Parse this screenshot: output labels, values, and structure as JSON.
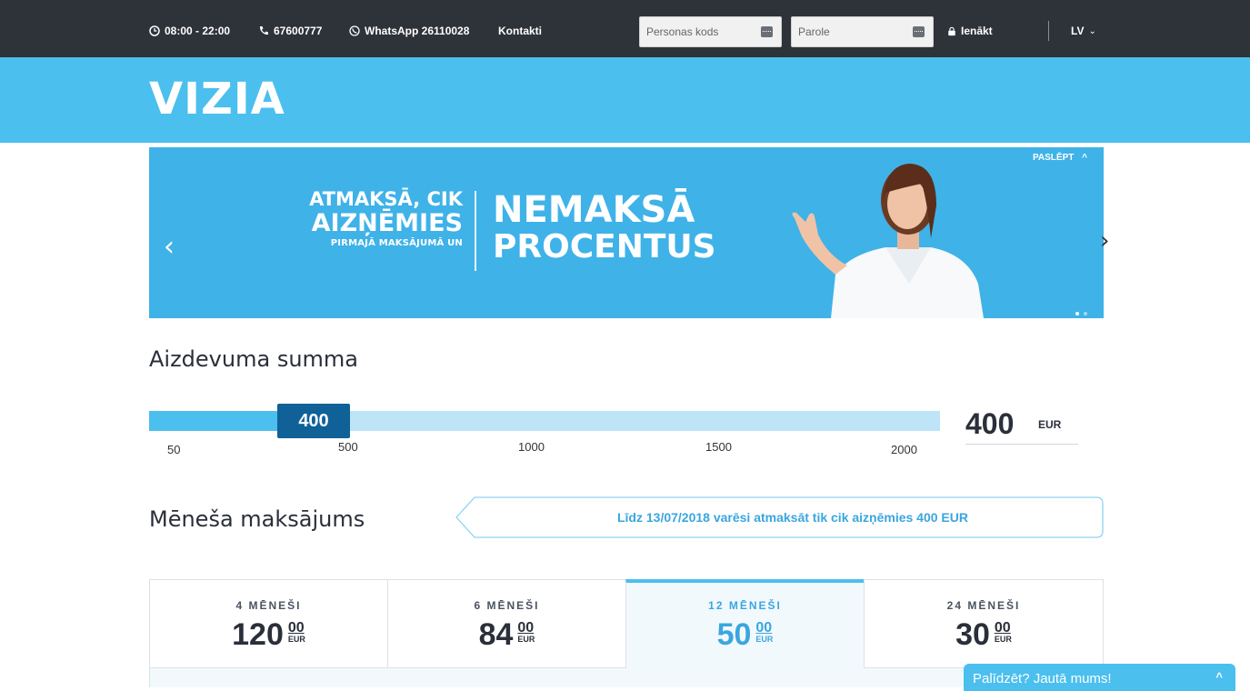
{
  "topbar": {
    "hours": "08:00 - 22:00",
    "phone": "67600777",
    "whatsapp": "WhatsApp 26110028",
    "contacts": "Kontakti",
    "personal_code_placeholder": "Personas kods",
    "password_placeholder": "Parole",
    "login": "Ienākt",
    "language": "LV"
  },
  "header": {
    "logo": "VIZIA"
  },
  "banner": {
    "left_line1": "ATMAKSĀ, CIK",
    "left_line2": "AIZŅĒMIES",
    "left_line3": "PIRMAJĀ MAKSĀJUMĀ UN",
    "right_line1": "NEMAKSĀ",
    "right_line2": "PROCENTUS",
    "hide_label": "PASLĒPT",
    "slides": 2,
    "active_slide": 1
  },
  "loan": {
    "title": "Aizdevuma summa",
    "slider_value": "400",
    "slider_min": 50,
    "slider_max": 2000,
    "ticks": [
      "50",
      "500",
      "1000",
      "1500",
      "2000"
    ],
    "amount": "400",
    "currency": "EUR"
  },
  "monthly": {
    "title": "Mēneša maksājums",
    "promo": "Līdz 13/07/2018 varēsi atmaksāt tik cik aizņēmies 400 EUR",
    "plans": [
      {
        "label": "4 MĒNEŠI",
        "int": "120",
        "dec": "00",
        "cur": "EUR",
        "active": false
      },
      {
        "label": "6 MĒNEŠI",
        "int": "84",
        "dec": "00",
        "cur": "EUR",
        "active": false
      },
      {
        "label": "12 MĒNEŠI",
        "int": "50",
        "dec": "00",
        "cur": "EUR",
        "active": true
      },
      {
        "label": "24 MĒNEŠI",
        "int": "30",
        "dec": "00",
        "cur": "EUR",
        "active": false
      }
    ]
  },
  "help": {
    "label": "Palīdzēt? Jautā mums!"
  },
  "colors": {
    "topbar": "#2e3239",
    "brand_blue": "#4bbfee",
    "handle": "#0f6198",
    "accent_text": "#3aa6df"
  },
  "icons": [
    "clock-icon",
    "phone-icon",
    "whatsapp-icon",
    "keyboard-icon",
    "lock-icon",
    "chevron-down-icon",
    "chevron-up-icon",
    "arrow-left-icon",
    "arrow-right-icon"
  ]
}
